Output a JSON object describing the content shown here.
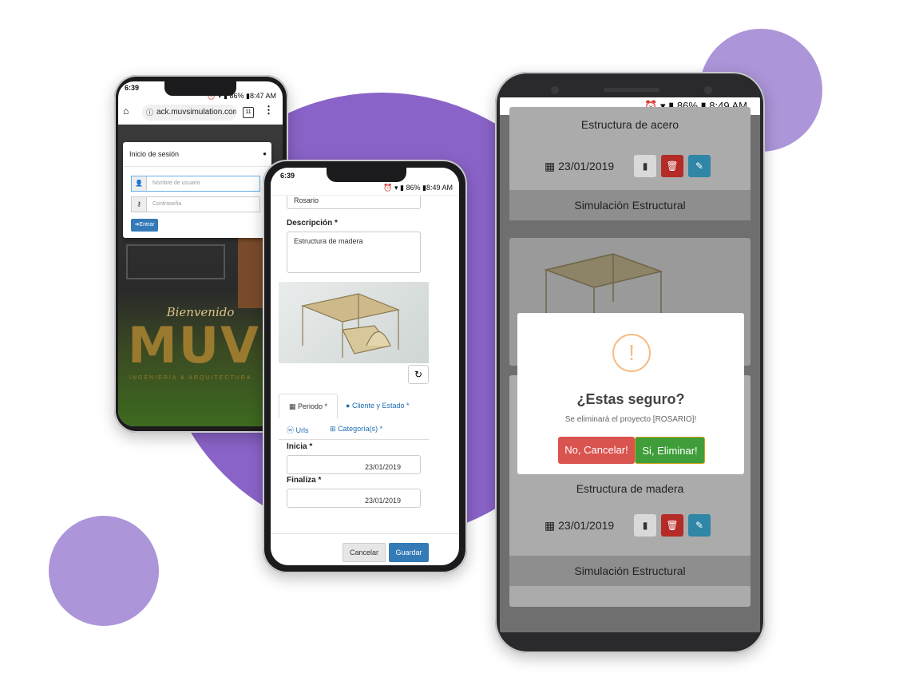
{
  "phone_login": {
    "status": {
      "time": "6:39",
      "right": "⏰ ▾ ▮ 86% ▮8:47 AM"
    },
    "browser": {
      "url": "ack.muvsimulation.com",
      "tabs_count": "11"
    },
    "login": {
      "title": "Inicio de sesión",
      "username_placeholder": "Nombre de usuario",
      "password_placeholder": "Contraseña",
      "submit_label": "Entrar"
    },
    "brand": {
      "welcome": "Bienvenido",
      "logo": "MUV",
      "tagline": "INGENIERIA & ARQUITECTURA"
    }
  },
  "phone_form": {
    "status": {
      "time": "6:39",
      "right": "⏰ ▾ ▮ 86% ▮8:49 AM"
    },
    "name_value": "Rosario",
    "description_label": "Descripción *",
    "description_value": "Estructura de madera",
    "tabs": [
      "Periodo *",
      "Cliente y Estado *",
      "Urls",
      "Categoría(s) *"
    ],
    "start_label": "Inicia *",
    "start_value": "23/01/2019",
    "end_label": "Finaliza *",
    "end_value": "23/01/2019",
    "cancel_label": "Cancelar",
    "save_label": "Guardar"
  },
  "phone_list": {
    "status": {
      "right": "⏰ ▾ ▮ 86% ▮ 8:49 AM"
    },
    "cards": [
      {
        "title": "Estructura de acero",
        "date": "23/01/2019",
        "footer": "Simulación Estructural"
      },
      {
        "title": "Estructura de madera",
        "date": "23/01/2019",
        "footer": "Simulación Estructural"
      }
    ],
    "dialog": {
      "icon": "!",
      "title": "¿Estas seguro?",
      "message": "Se eliminará el proyecto [ROSARIO]!",
      "cancel_label": "No, Cancelar!",
      "confirm_label": "Si, Eliminar!"
    }
  },
  "colors": {
    "purple_dark": "#8a63c8",
    "purple_light": "#ac95d9",
    "primary_blue": "#337ab7",
    "danger": "#d9534f",
    "success": "#5cb85c"
  }
}
